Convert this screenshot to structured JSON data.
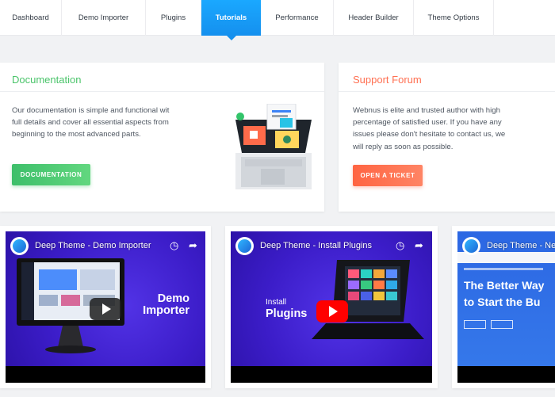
{
  "nav": {
    "tabs": [
      {
        "label": "Dashboard"
      },
      {
        "label": "Demo Importer"
      },
      {
        "label": "Plugins"
      },
      {
        "label": "Tutorials",
        "active": true
      },
      {
        "label": "Performance"
      },
      {
        "label": "Header Builder"
      },
      {
        "label": "Theme Options"
      }
    ]
  },
  "documentation": {
    "title": "Documentation",
    "text": "Our documentation is simple and functional wit full details and cover all essential aspects from beginning to the most advanced parts.",
    "button": "DOCUMENTATION"
  },
  "support": {
    "title": "Support Forum",
    "text": "Webnus is elite and trusted author with high percentage of satisfied user. If you have any issues please don't hesitate to contact us, we will reply as soon as possible.",
    "button": "OPEN A TICKET"
  },
  "videos": [
    {
      "title": "Deep Theme - Demo Importer",
      "overlay_line1": "Demo",
      "overlay_line2": "Importer"
    },
    {
      "title": "Deep Theme - Install Plugins",
      "overlay_line1": "Install",
      "overlay_line2": "Plugins"
    },
    {
      "title": "Deep Theme - Ne",
      "overlay_line1": "The Better Way",
      "overlay_line2": "to Start the Bu"
    }
  ],
  "colors": {
    "accent": "#1590ee",
    "doc_green": "#4ac46a",
    "support_orange": "#ff7052",
    "video_purple": "#3c1dc9",
    "youtube_red": "#ff0000"
  }
}
